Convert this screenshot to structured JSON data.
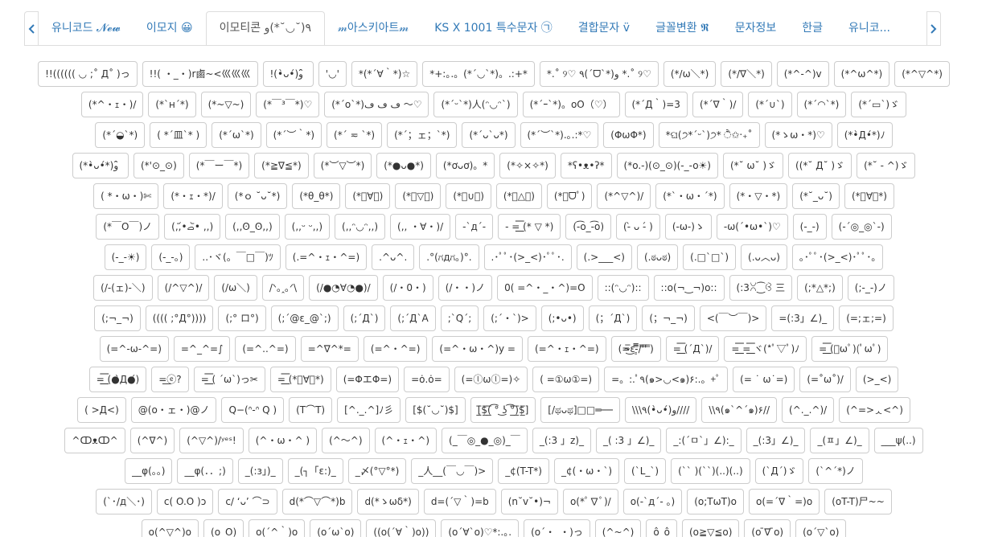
{
  "tabs": [
    {
      "label": "유니코드 𝓝𝓮𝔀",
      "active": false
    },
    {
      "label": "이모지 😀",
      "active": false
    },
    {
      "label": "이모티콘 ٩(˘◡˘*)و",
      "active": true
    },
    {
      "label": "𝓂아스키아트𝓂",
      "active": false
    },
    {
      "label": "KS X 1001 특수문자 ㉠",
      "active": false
    },
    {
      "label": "결합문자 v̈",
      "active": false
    },
    {
      "label": "글꼴변환 𝕽",
      "active": false
    },
    {
      "label": "문자정보",
      "active": false
    },
    {
      "label": "한글",
      "active": false
    },
    {
      "label": "유니코...",
      "active": false
    }
  ],
  "rows": [
    [
      "!!(((((( ◡ ;˚ Д˚ )っ",
      "!!( ・_・)r鹵~<巛巛巛",
      "!(•̀ᴗ•́)و ̑̑",
      "'◡'",
      "*(*´∀｀*)☆",
      "*+:｡.。(*´◡`*)。.:+*",
      "*.˚ ୨♡ ٩(ˊᗜˋ*)و *.˚ ୨♡",
      "(*/ω＼*)",
      "(*/∇＼*)",
      "(*^-^)v",
      "(*^ω^*)",
      "(*^▽^*)"
    ],
    [
      "(*^・ｪ・)/",
      "(*`н´*)",
      "(*~▽~)",
      "(*￣³￣*)♡",
      "(*´o`*)ڡ ڡ ڡ ～♡",
      "(*´ᵕ`*)人(ᵔ◡ᵔ`)",
      "(*´ｰ`*)。oO（♡）",
      "(*´Д｀)=3",
      "(*´∇｀)/",
      "(*´∪`)",
      "(*´◠`*)",
      "(*´▭`)ゞ"
    ],
    [
      "(*´◒`*)",
      "( *´皿`* )",
      "(*´ω`*)",
      "(*´︶｀*)",
      "(*´ ≂ `*)",
      "(*´；ェ；`*)",
      "(*´ᴗ`ᴗ*)",
      "(*´︶`*).｡.:*♡",
      "(ΦωΦ*)",
      "*ଘ(੭*ˊᵕˋ)੭* ੈ✩‧₊˚",
      "(*ゝω・*)♡",
      "(*•̀Д•́*)ﾉ"
    ],
    [
      "(*•̀ᴗ•́*)و ̑̑",
      "(*'⊙_⊙)",
      "(*￣ー￣*)",
      "(*≧∇≦*)",
      "(*︶▽︶*)",
      "(*●ᴗ●*)",
      "(*ơᴗơ)。*",
      "(*✧×✧*)",
      "*ʕ•ᴥ•ʔ*",
      "(*o.-)(⊙_⊙)(-_-o☀)",
      "(*˘ ω˘ )ゞ",
      "((*˘ Д˘ )ゞ",
      "(*˘ - ^)ゞ"
    ],
    [
      "( *・ω・)✄",
      "(*・ｪ・*)/",
      "(*ｏ ˘ᴗ˘*)",
      "(*θ_θ*)",
      "(*ﾟ∀ﾟ)",
      "(*ﾟ▽ﾟ)",
      "(*ﾟ∪ﾟ)",
      "(*ﾟ△ﾟ)",
      "(*ﾟᗜﾟ)",
      "(*^▽^)/",
      "(*`・ω・´*)",
      "(*・▽・*)",
      "(*˘_ᴗ˘)",
      "(*ﾟ∀ﾟ*)"
    ],
    [
      "(*￣O￣)ノ",
      "(,,•᷄‎ࡇ•᷅ ,,)",
      "(,,ʘ_ʘ,,)",
      "(,,ᵕ ᵕ,,)",
      "(,,ᵔ◡ᵔ,,)",
      "(,, ・∀・)/",
      "-`д´-",
      "- =͟͟͞͞ (* ▽ *)",
      "(-͡o_-͡o)",
      "(-̀ ᴗ -́ )",
      "(-ω-)ゝ",
      "-ω(´•ω•`)♡",
      "(-_-)",
      "(-´◎_◎`-)"
    ],
    [
      "(-_-☀)",
      "(-_-。)",
      "..･ヾ(。￣□￣)ﾂ",
      "(.=^・ｪ・^=)",
      ".^ᴗ^.",
      ".°(ಗдಗ。)°.",
      ".･ﾟﾟ･(>_<)･ﾟﾟ･.",
      "(.>___<)",
      "(.ಠᴗಠ)",
      "(.□`□`)",
      "(.ᴗ︿ᴗ)",
      "｡･ﾟﾟ･(>_<)･ﾟﾟ･｡"
    ],
    [
      "(/-(ェ)-＼)",
      "(/^▽^)/",
      "(/ω＼)",
      "/ᐠ｡ꞈ｡ᐟ\\",
      "(/●◔∀◔●)/",
      "(/・0・)",
      "(/・・)ノ",
      "0( =^・_・^)=O",
      "::(ᵔ◡ᵔ)::",
      "::o(¬‿¬)o::",
      "(:3ꇤ⁐ꃳ 三",
      "(;*△*;)",
      "(;-_-)ノ"
    ],
    [
      "(;¬_¬)",
      "(((( ;°Д°))))",
      "(;° ロ°)",
      "(;´@ε_@`;)",
      "(;´Д`)",
      "(;´Д`A",
      ";`Q´;",
      "(;´・`)>",
      "(;•ᴗ•)",
      "(；´Д`)",
      "(；¬_¬)",
      "<(￣︶￣)>",
      "=(:3」∠)_",
      "(=;ェ;=)"
    ],
    [
      "(=^-ω-^=)",
      "=^_^=∫",
      "(=^..^=)",
      "=^∇^*=",
      "(=^・^=)",
      "(=^・ω・^)y =",
      "(=^・ｪ・^=)",
      "(=̴̅͜ε ̵͇̿̿/'̿'̿ ̿)",
      "=͟͟͞͞ (´Д`)/",
      "=͟͟͞͞ =͟͟͞͞ ヾ(*ﾟ▽ﾟ)ﾉ",
      "=͟͟͞͞ (ﾟωﾟ)(ﾟωﾟ)"
    ],
    [
      "=͟͟͞͞ (●̀Д●́)",
      "=͟ⓔ?",
      "=͟͟͞͞ ( ´ω`)っ✂",
      "=͟͟͞͞ (*ﾟ∀ﾟ*)",
      "(=ΦエΦ=)",
      "=ȯ.ȯ=",
      "(=ⓛωⓛ=)✧",
      "( =①ω①=)",
      "=。:.ﾟ٩(๑>◡<๑)۶:.。+ﾟ",
      "(= ˙ ω˙=)",
      "(=˚ω˚)/",
      "(>_<)"
    ],
    [
      "( >Д<)",
      "@(o・ェ・)@ノ",
      "Q−(ᐢ-ᐢ Q )",
      "(T⌒T)",
      "[^._.^]ﾉ彡",
      "[$(˘◡˘)$]",
      "[̲̅$̲̅(̲̅ ͡° ͜ʖ ͡°̲̅)̲̅$̲̅]",
      "[/ಥᴗಥ]□□═──",
      "\\\\\\٩(•̀ᴗ•́)و////",
      "\\\\٩(๑`^´๑)۶//",
      "(^._.^)/",
      "(^=>ᆺ<^)"
    ],
    [
      "^ↀᴥↀ^",
      "(^∇^)",
      "(^▽^)/ʸᵉˢ!",
      "(^・ω・^ )",
      "(^～^)",
      "(^・ｪ・^)",
      "(_￣◎_●_◎)_￣",
      "_(:3 」z)_",
      "_( :3 」∠)_",
      "_:(´ㅁ`」∠):_",
      "_(:3」∠)_",
      "_(ㅍ」∠)_",
      "___ψ(..)"
    ],
    [
      "__φ(。。)",
      "__φ(．．;)",
      "_(:з」)_",
      "_(┐「ε:)_",
      "_〆(°▽°*)",
      "_人__(￣◡￣)>",
      "_¢(T-T*)",
      "_¢(・ω・`)",
      "(`L_`)",
      "(`` )(``)(..)(..)",
      "(`Д´)ゞ",
      "(`^´*)ノ"
    ],
    [
      "(`･/д＼･)",
      "c( O.O )ɔ",
      "c/ ‘ᴗ’ ⌒⊃",
      "d(*⌒▽⌒*)b",
      "d(*ゝωδ*)",
      "d=(´▽｀)=b",
      "(n˘v˘•)¬",
      "o(*ﾟ∇ﾟ)/",
      "o(-`д´- 。)",
      "(o;TωT)o",
      "o(=´∇｀=)o",
      "(oT-T)尸~~"
    ],
    [
      "o(^▽^)o",
      "(o_O)",
      "o(´^｀)o",
      "(o´ω`o)",
      "((o(´∀｀)o))",
      "(o´∀`o)♡*:.｡.",
      "(o´・_・)っ",
      "(^~^)",
      "ô_ô",
      "(o≧▽≦o)",
      "(o ̄∇ ̄o)",
      "(o´▽`o)"
    ]
  ]
}
